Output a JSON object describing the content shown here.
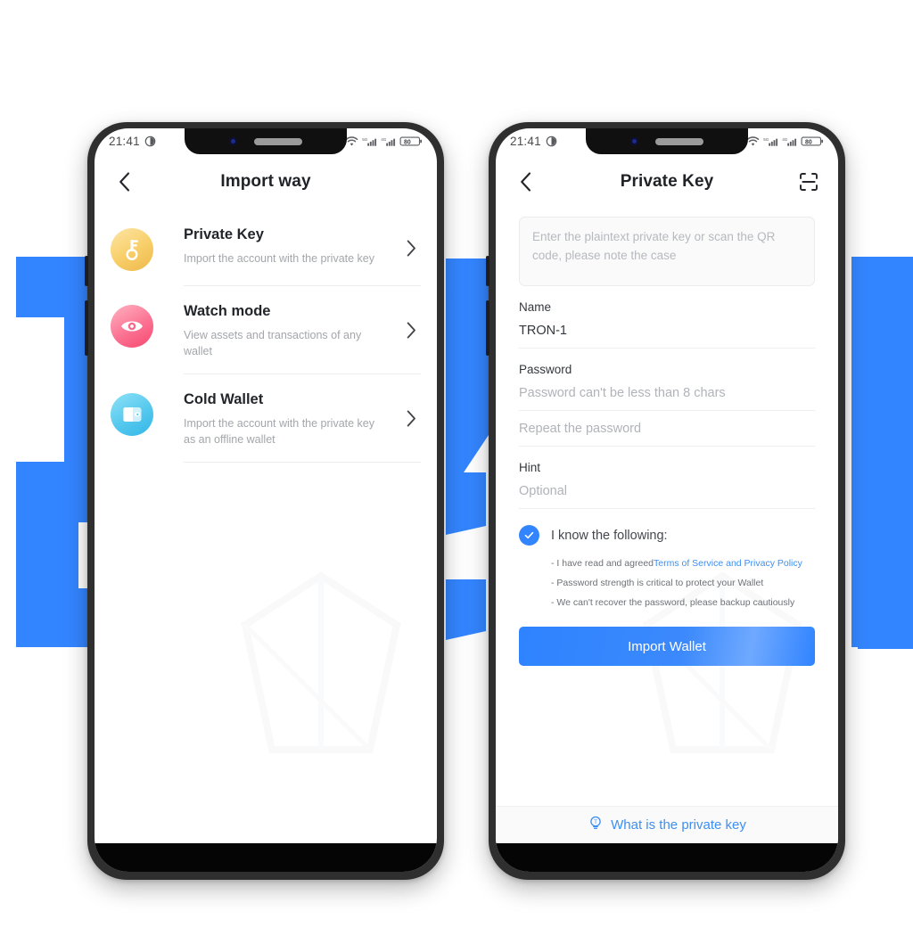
{
  "background": {
    "wordmark": "TRON",
    "color": "#3385ff"
  },
  "phone_left": {
    "status_bar": {
      "time": "21:41",
      "alarm_icon": "alarm-icon",
      "wifi_icon": "wifi-icon",
      "signal_1_label": "5G",
      "signal_2_label": "4G",
      "battery_level": "80"
    },
    "header": {
      "back_icon": "chevron-left-icon",
      "title": "Import way"
    },
    "list": [
      {
        "icon": "key-icon",
        "title": "Private Key",
        "subtitle": "Import the account with the private key",
        "chevron": "chevron-right-icon"
      },
      {
        "icon": "eye-icon",
        "title": "Watch mode",
        "subtitle": "View assets and transactions of any wallet",
        "chevron": "chevron-right-icon"
      },
      {
        "icon": "wallet-icon",
        "title": "Cold Wallet",
        "subtitle": "Import the account with the private key as an offline wallet",
        "chevron": "chevron-right-icon"
      }
    ]
  },
  "phone_right": {
    "status_bar": {
      "time": "21:41",
      "alarm_icon": "alarm-icon",
      "wifi_icon": "wifi-icon",
      "signal_1_label": "5G",
      "signal_2_label": "4G",
      "battery_level": "80"
    },
    "header": {
      "back_icon": "chevron-left-icon",
      "title": "Private Key",
      "scan_icon": "qr-scan-icon"
    },
    "form": {
      "private_key_placeholder": "Enter the plaintext private key or scan the QR code, please note the case",
      "private_key_value": "",
      "name_label": "Name",
      "name_value": "TRON-1",
      "name_placeholder": "",
      "password_label": "Password",
      "password_placeholder": "Password can't be less than 8 chars",
      "password_value": "",
      "repeat_placeholder": "Repeat the password",
      "repeat_value": "",
      "hint_label": "Hint",
      "hint_placeholder": "Optional",
      "hint_value": ""
    },
    "agreement": {
      "checked": true,
      "check_icon": "check-icon",
      "title": "I know the following:",
      "items": [
        {
          "prefix": "- I have read and agreed",
          "link": "Terms of Service and Privacy Policy"
        },
        {
          "prefix": "- Password strength is critical to protect your Wallet",
          "link": ""
        },
        {
          "prefix": "- We can't recover the password, please backup cautiously",
          "link": ""
        }
      ]
    },
    "submit_label": "Import Wallet",
    "bottom_bar": {
      "icon": "lightbulb-icon",
      "label": "What is the private key"
    },
    "accent_color": "#3385ff",
    "link_color": "#3d8ff2"
  }
}
